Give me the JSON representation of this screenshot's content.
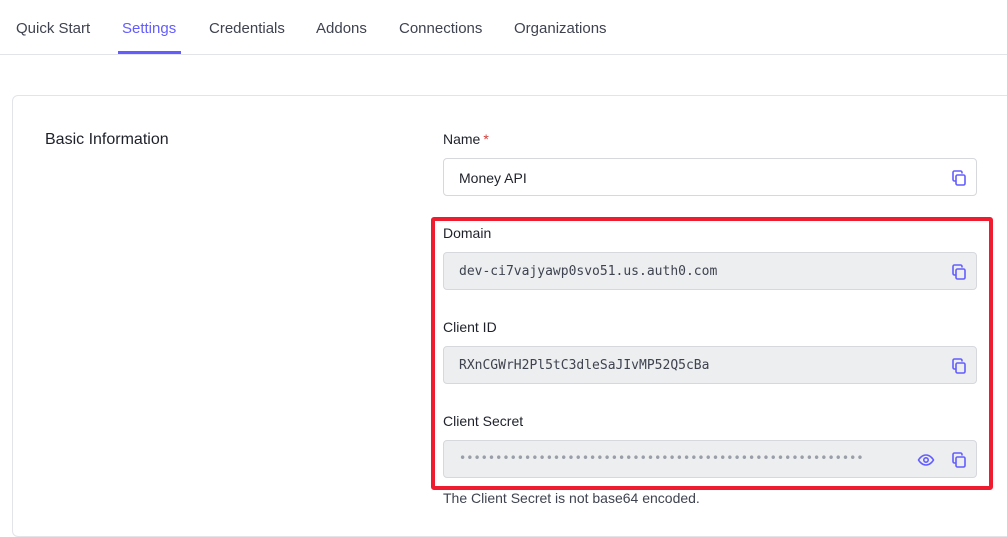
{
  "tabs": [
    {
      "label": "Quick Start"
    },
    {
      "label": "Settings",
      "active": true
    },
    {
      "label": "Credentials"
    },
    {
      "label": "Addons"
    },
    {
      "label": "Connections"
    },
    {
      "label": "Organizations"
    }
  ],
  "section": {
    "title": "Basic Information"
  },
  "fields": {
    "name": {
      "label": "Name",
      "required_mark": "*",
      "value": "Money API",
      "icon": "copy-icon"
    },
    "domain": {
      "label": "Domain",
      "value": "dev-ci7vajyawp0svo51.us.auth0.com",
      "icon": "copy-icon"
    },
    "client_id": {
      "label": "Client ID",
      "value": "RXnCGWrH2Pl5tC3dleSaJIvMP52Q5cBa",
      "icon": "copy-icon"
    },
    "client_secret": {
      "label": "Client Secret",
      "value": "••••••••••••••••••••••••••••••••••••••••••••••••••••••••",
      "icons": [
        "eye-icon",
        "copy-icon"
      ],
      "helper": "The Client Secret is not base64 encoded."
    }
  },
  "colors": {
    "accent": "#635dff",
    "highlight": "#ee1c2e",
    "required": "#d03c38"
  }
}
